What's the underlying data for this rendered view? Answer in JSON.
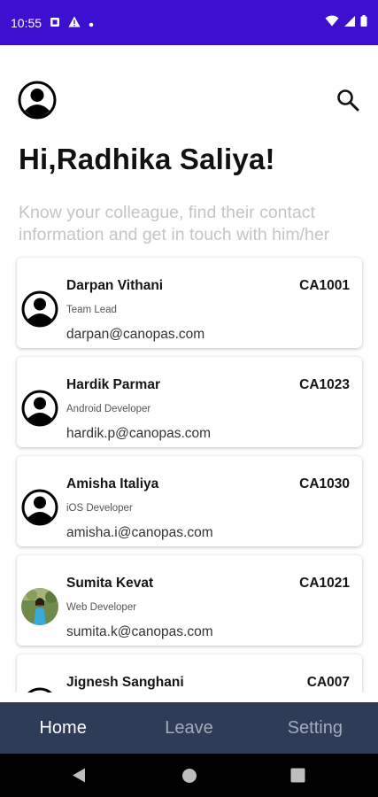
{
  "status_bar": {
    "time": "10:55",
    "background": "#3d10cf"
  },
  "header": {
    "greeting": "Hi,Radhika Saliya!",
    "subtitle": "Know your colleague, find their contact information and get in touch with him/her"
  },
  "employees": [
    {
      "name": "Darpan Vithani",
      "code": "CA1001",
      "role": "Team Lead",
      "email": "darpan@canopas.com",
      "avatar": "person-icon"
    },
    {
      "name": "Hardik Parmar",
      "code": "CA1023",
      "role": "Android Developer",
      "email": "hardik.p@canopas.com",
      "avatar": "person-icon"
    },
    {
      "name": "Amisha Italiya",
      "code": "CA1030",
      "role": "iOS Developer",
      "email": "amisha.i@canopas.com",
      "avatar": "person-icon"
    },
    {
      "name": "Sumita Kevat",
      "code": "CA1021",
      "role": "Web Developer",
      "email": "sumita.k@canopas.com",
      "avatar": "photo"
    },
    {
      "name": "Jignesh Sanghani",
      "code": "CA007",
      "role": "",
      "email": "",
      "avatar": "person-icon"
    }
  ],
  "bottom_nav": {
    "items": [
      "Home",
      "Leave",
      "Setting"
    ],
    "active": "Home",
    "background": "#2e3c58"
  }
}
